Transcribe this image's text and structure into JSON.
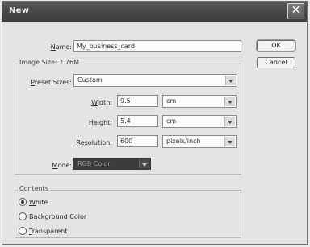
{
  "window": {
    "title": "New",
    "close_glyph": "✕"
  },
  "name": {
    "label_u": "N",
    "label_rest": "ame:",
    "value": "My_business_card"
  },
  "buttons": {
    "ok": "OK",
    "cancel": "Cancel"
  },
  "image_size": {
    "legend": "Image Size: 7.76M",
    "preset": {
      "label_u": "P",
      "label_rest": "reset Sizes:",
      "value": "Custom"
    },
    "width": {
      "label_u": "W",
      "label_rest": "idth:",
      "value": "9.5",
      "unit": "cm"
    },
    "height": {
      "label_u": "H",
      "label_rest": "eight:",
      "value": "5.4",
      "unit": "cm"
    },
    "resolution": {
      "label_u": "R",
      "label_rest": "esolution:",
      "value": "600",
      "unit": "pixels/inch"
    },
    "mode": {
      "label_u": "M",
      "label_rest": "ode:",
      "value": "RGB Color"
    }
  },
  "contents": {
    "legend": "Contents",
    "options": [
      {
        "u": "W",
        "rest": "hite",
        "selected": true
      },
      {
        "u": "B",
        "rest": "ackground Color",
        "selected": false
      },
      {
        "u": "T",
        "rest": "ransparent",
        "selected": false
      }
    ]
  }
}
